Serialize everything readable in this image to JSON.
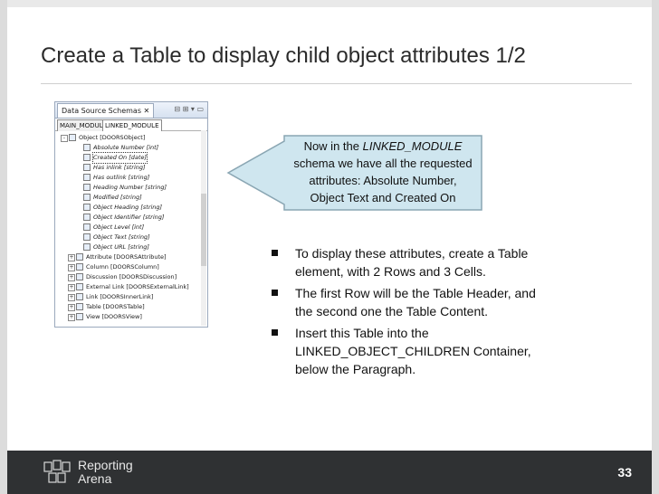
{
  "slide": {
    "title": "Create a Table to display child object attributes 1/2",
    "page_number": "33"
  },
  "view": {
    "tab_title": "Data Source Schemas",
    "tab_close": "✕",
    "buttons": "⊟ ⊞ ▾ ▭",
    "subtabs": [
      "MAIN_MODULE",
      "LINKED_MODULE"
    ],
    "tree": [
      {
        "label": "Object [DOORSObject]",
        "italic": false,
        "expander": "-"
      },
      {
        "label": "Absolute Number [int]",
        "italic": true,
        "expander": ""
      },
      {
        "label": "Created On [date]",
        "italic": true,
        "expander": "",
        "selected": true
      },
      {
        "label": "Has inlink [string]",
        "italic": true,
        "expander": ""
      },
      {
        "label": "Has outlink [string]",
        "italic": true,
        "expander": ""
      },
      {
        "label": "Heading Number [string]",
        "italic": true,
        "expander": ""
      },
      {
        "label": "Modified [string]",
        "italic": true,
        "expander": ""
      },
      {
        "label": "Object Heading [string]",
        "italic": true,
        "expander": ""
      },
      {
        "label": "Object Identifier [string]",
        "italic": true,
        "expander": ""
      },
      {
        "label": "Object Level [int]",
        "italic": true,
        "expander": ""
      },
      {
        "label": "Object Text [string]",
        "italic": true,
        "expander": ""
      },
      {
        "label": "Object URL [string]",
        "italic": true,
        "expander": ""
      },
      {
        "label": "Attribute [DOORSAttribute]",
        "italic": false,
        "expander": "+"
      },
      {
        "label": "Column [DOORSColumn]",
        "italic": false,
        "expander": "+"
      },
      {
        "label": "Discussion [DOORSDiscussion]",
        "italic": false,
        "expander": "+"
      },
      {
        "label": "External Link [DOORSExternalLink]",
        "italic": false,
        "expander": "+"
      },
      {
        "label": "Link [DOORSInnerLink]",
        "italic": false,
        "expander": "+"
      },
      {
        "label": "Table [DOORSTable]",
        "italic": false,
        "expander": "+"
      },
      {
        "label": "View [DOORSView]",
        "italic": false,
        "expander": "+"
      }
    ]
  },
  "callout": {
    "line1_prefix": "Now in the ",
    "line1_emph": "LINKED_MODULE",
    "line2": "schema we have all the requested",
    "line3": "attributes: Absolute Number,",
    "line4": "Object Text and Created On",
    "fill": "#cfe6ef",
    "border": "#8aa6b3"
  },
  "bullets": [
    "To display these attributes, create a Table element, with 2 Rows and 3 Cells.",
    "The first Row will be the Table Header, and the second one the Table Content.",
    "Insert this Table into the LINKED_OBJECT_CHILDREN Container, below the Paragraph."
  ],
  "footer": {
    "brand_line1": "Reporting",
    "brand_line2": "Arena",
    "background": "#2f3133",
    "logo_icon": "reporting-arena-logo"
  }
}
